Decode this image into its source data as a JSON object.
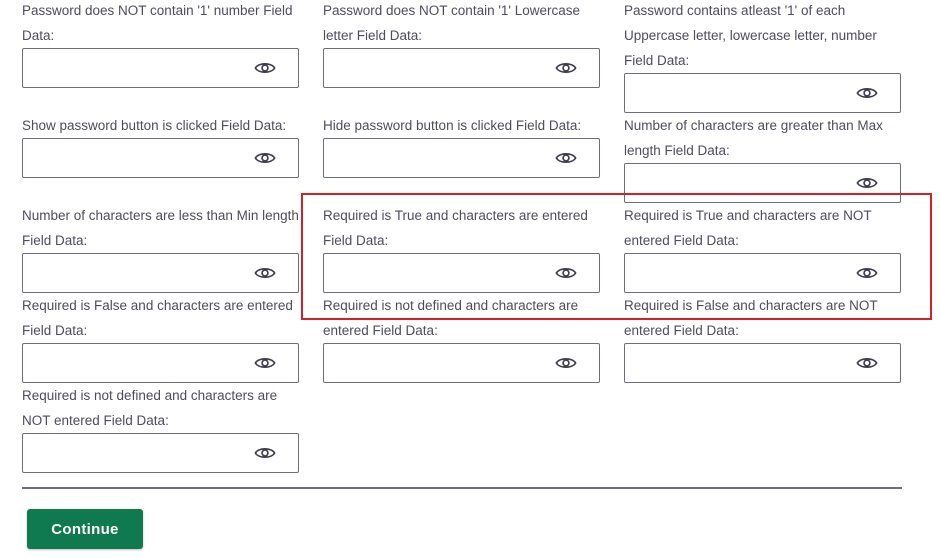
{
  "fields": [
    {
      "label": "Password does NOT contain '1' number Field Data:",
      "value": ""
    },
    {
      "label": "Password does NOT contain '1' Lowercase letter Field Data:",
      "value": ""
    },
    {
      "label": "Password contains atleast '1' of each Uppercase letter, lowercase letter, number Field Data:",
      "value": ""
    },
    {
      "label": "Show password button is clicked Field Data:",
      "value": ""
    },
    {
      "label": "Hide password button is clicked Field Data:",
      "value": ""
    },
    {
      "label": "Number of characters are greater than Max length Field Data:",
      "value": ""
    },
    {
      "label": "Number of characters are less than Min length Field Data:",
      "value": ""
    },
    {
      "label": "Required is True and characters are entered Field Data:",
      "value": ""
    },
    {
      "label": "Required is True and characters are NOT entered Field Data:",
      "value": ""
    },
    {
      "label": "Required is False and characters are entered Field Data:",
      "value": ""
    },
    {
      "label": "Required is not defined and characters are entered Field Data:",
      "value": ""
    },
    {
      "label": "Required is False and characters are NOT entered Field Data:",
      "value": ""
    },
    {
      "label": "Required is not defined and characters are NOT entered Field Data:",
      "value": ""
    }
  ],
  "icons": {
    "visibility_toggle": "eye-icon"
  },
  "actions": {
    "continue_label": "Continue"
  },
  "colors": {
    "primary_button": "#0f7a4f",
    "highlight_border": "#d61f26",
    "input_border": "#6e6e7a",
    "label_text": "#4d4d5c"
  }
}
